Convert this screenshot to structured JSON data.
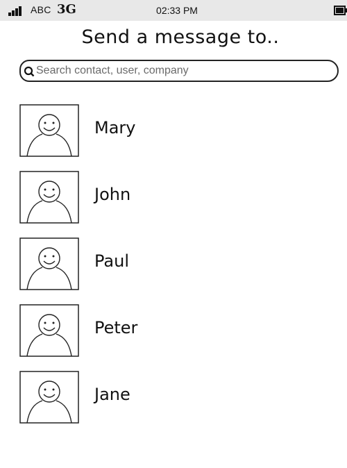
{
  "status_bar": {
    "carrier": "ABC",
    "network": "3G",
    "time": "02:33 PM",
    "icons": [
      "signal-bars-icon",
      "battery-icon"
    ]
  },
  "header": {
    "title": "Send a message to.."
  },
  "search": {
    "placeholder": "Search contact, user, company",
    "value": "",
    "icon": "search-icon"
  },
  "contacts": [
    {
      "name": "Mary",
      "avatar_icon": "person-placeholder-icon"
    },
    {
      "name": "John",
      "avatar_icon": "person-placeholder-icon"
    },
    {
      "name": "Paul",
      "avatar_icon": "person-placeholder-icon"
    },
    {
      "name": "Peter",
      "avatar_icon": "person-placeholder-icon"
    },
    {
      "name": "Jane",
      "avatar_icon": "person-placeholder-icon"
    }
  ]
}
